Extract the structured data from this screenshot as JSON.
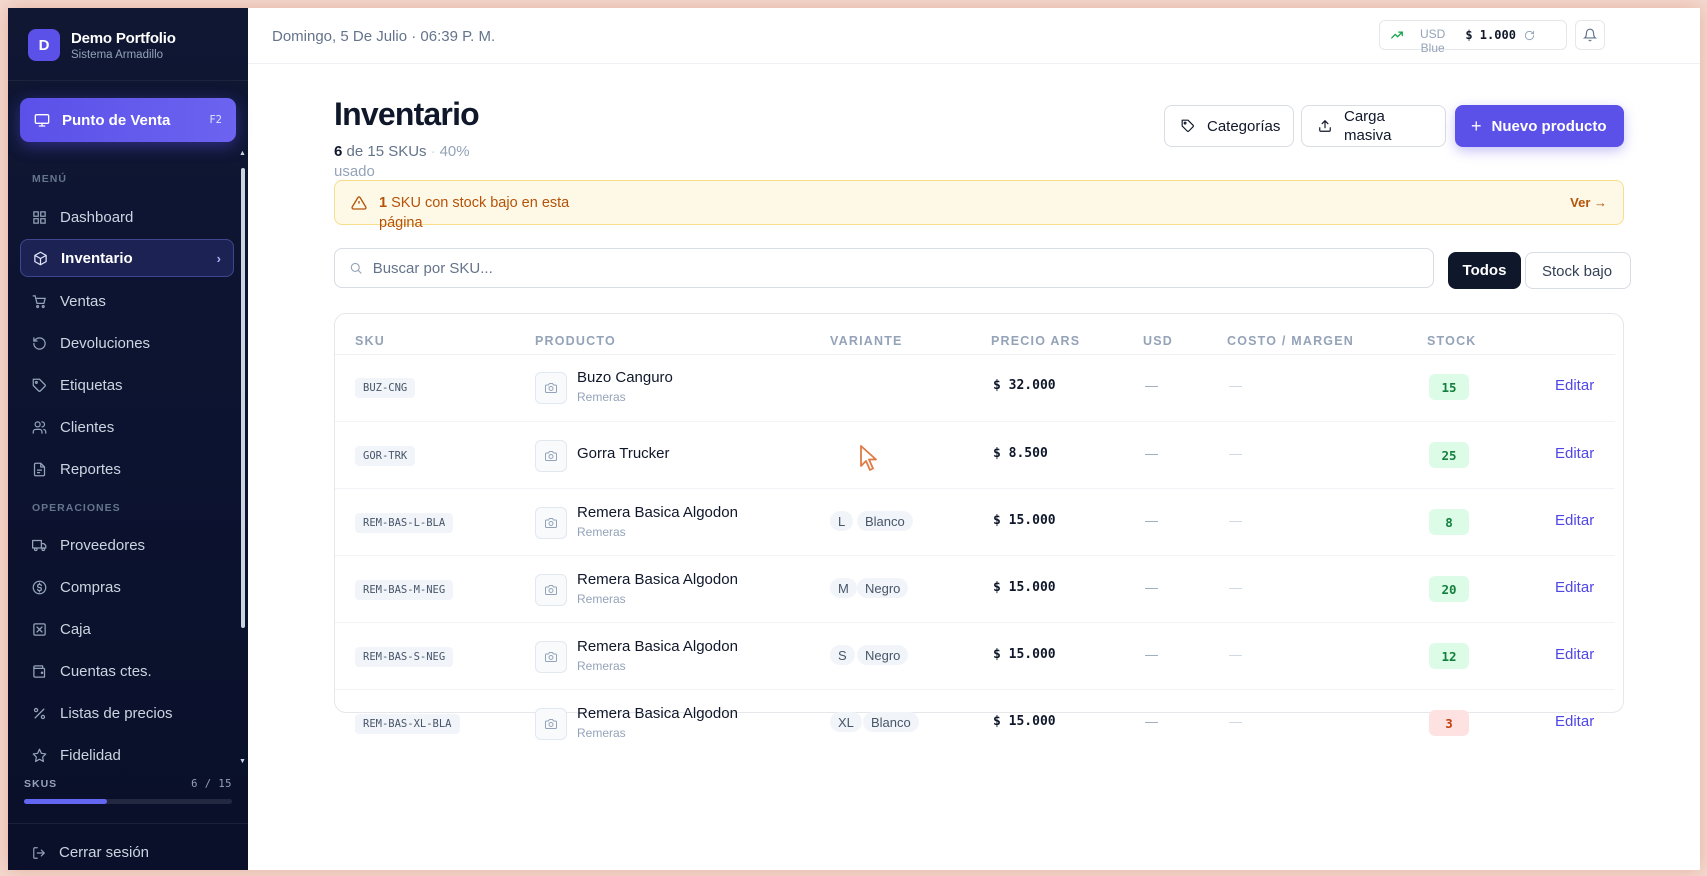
{
  "brand": {
    "initial": "D",
    "name": "Demo Portfolio",
    "subtitle": "Sistema Armadillo"
  },
  "pos": {
    "label": "Punto de Venta",
    "shortcut": "F2"
  },
  "sidebar": {
    "menu_label": "MENÚ",
    "menu_items": [
      {
        "label": "Dashboard",
        "icon": "grid-icon"
      },
      {
        "label": "Inventario",
        "icon": "box-icon",
        "active": true
      },
      {
        "label": "Ventas",
        "icon": "cart-icon"
      },
      {
        "label": "Devoluciones",
        "icon": "rotate-ccw-icon"
      },
      {
        "label": "Etiquetas",
        "icon": "tag-icon"
      },
      {
        "label": "Clientes",
        "icon": "users-icon"
      },
      {
        "label": "Reportes",
        "icon": "file-icon"
      }
    ],
    "ops_label": "OPERACIONES",
    "ops_items": [
      {
        "label": "Proveedores",
        "icon": "truck-icon"
      },
      {
        "label": "Compras",
        "icon": "dollar-circle-icon"
      },
      {
        "label": "Caja",
        "icon": "cash-box-icon"
      },
      {
        "label": "Cuentas ctes.",
        "icon": "wallet-icon"
      },
      {
        "label": "Listas de precios",
        "icon": "percent-icon"
      },
      {
        "label": "Fidelidad",
        "icon": "star-icon"
      }
    ],
    "skus_label": "SKUS",
    "skus_count": "6 / 15",
    "skus_fraction": 0.4,
    "logout_label": "Cerrar sesión"
  },
  "topbar": {
    "date": "Domingo, 5 De Julio · 06:39 P. M.",
    "fx_currency": "USD",
    "fx_type": "Blue",
    "fx_value": "$ 1.000"
  },
  "page": {
    "title": "Inventario",
    "used_count": "6",
    "used_total": "de 15 SKUs",
    "used_pct": "40% usado",
    "categories_label": "Categorías",
    "bulk_label": "Carga masiva",
    "new_label": "Nuevo producto"
  },
  "alert": {
    "count": "1",
    "text": "SKU con stock bajo en esta página",
    "link": "Ver →"
  },
  "search": {
    "placeholder": "Buscar por SKU..."
  },
  "filters": {
    "all": "Todos",
    "low": "Stock bajo"
  },
  "table": {
    "headers": [
      "SKU",
      "PRODUCTO",
      "VARIANTE",
      "PRECIO ARS",
      "USD",
      "COSTO / MARGEN",
      "STOCK"
    ],
    "edit_label": "Editar",
    "rows": [
      {
        "sku": "BUZ-CNG",
        "name": "Buzo Canguro",
        "category": "Remeras",
        "size": "",
        "color": "",
        "price": "$ 32.000",
        "usd": "—",
        "cost": "—",
        "stock": "15",
        "low": false
      },
      {
        "sku": "GOR-TRK",
        "name": "Gorra Trucker",
        "category": "",
        "size": "",
        "color": "",
        "price": "$ 8.500",
        "usd": "—",
        "cost": "—",
        "stock": "25",
        "low": false
      },
      {
        "sku": "REM-BAS-L-BLA",
        "name": "Remera Basica Algodon",
        "category": "Remeras",
        "size": "L",
        "color": "Blanco",
        "price": "$ 15.000",
        "usd": "—",
        "cost": "—",
        "stock": "8",
        "low": false
      },
      {
        "sku": "REM-BAS-M-NEG",
        "name": "Remera Basica Algodon",
        "category": "Remeras",
        "size": "M",
        "color": "Negro",
        "price": "$ 15.000",
        "usd": "—",
        "cost": "—",
        "stock": "20",
        "low": false
      },
      {
        "sku": "REM-BAS-S-NEG",
        "name": "Remera Basica Algodon",
        "category": "Remeras",
        "size": "S",
        "color": "Negro",
        "price": "$ 15.000",
        "usd": "—",
        "cost": "—",
        "stock": "12",
        "low": false
      },
      {
        "sku": "REM-BAS-XL-BLA",
        "name": "Remera Basica Algodon",
        "category": "Remeras",
        "size": "XL",
        "color": "Blanco",
        "price": "$ 15.000",
        "usd": "—",
        "cost": "—",
        "stock": "3",
        "low": true
      }
    ]
  },
  "colors": {
    "accent": "#5b50e8",
    "sidebar_bg": "#0f1733",
    "warning": "#b45309",
    "stock_ok": "#15803d",
    "stock_low": "#c2410c"
  }
}
